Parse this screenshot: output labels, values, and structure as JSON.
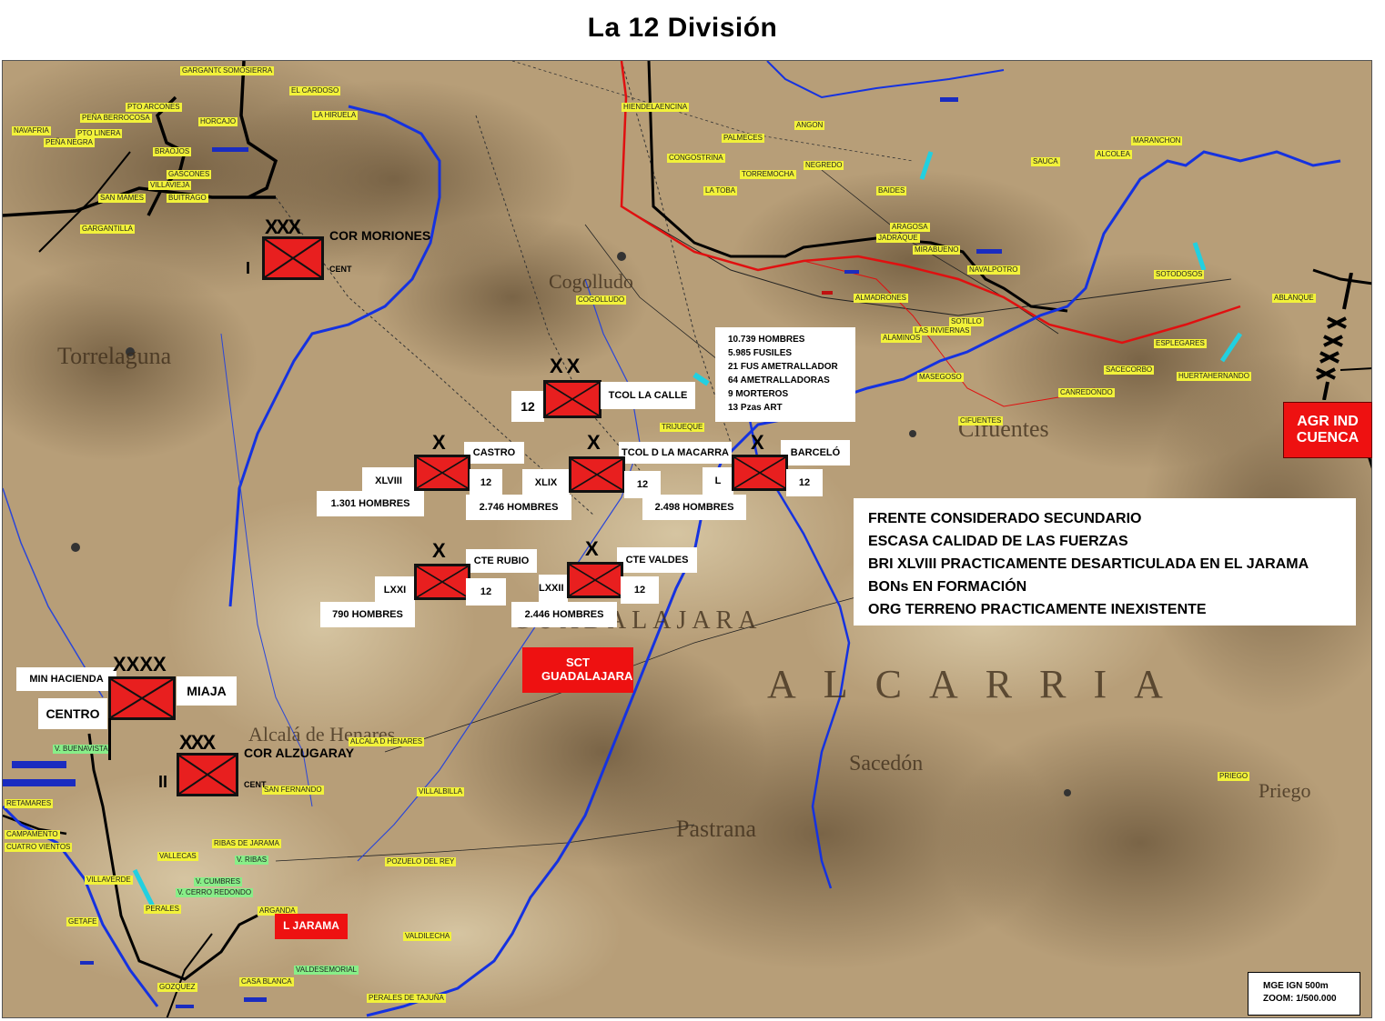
{
  "title": "La 12 División",
  "colors": {
    "unit_fill": "#e81f1f",
    "river": "#1532e0",
    "front_line": "#e01010",
    "map_base": "#b79e78"
  },
  "corps": [
    {
      "echelon": "XXX",
      "name": "COR MORIONES",
      "number": "I",
      "sub": "CENT"
    },
    {
      "echelon": "XXX",
      "name": "COR ALZUGARAY",
      "number": "II",
      "sub": "CENT"
    }
  ],
  "army": {
    "echelon": "XXXX",
    "name": "MIAJA",
    "top_label": "MIN HACIENDA",
    "side_label": "CENTRO"
  },
  "division": {
    "echelon": "XX",
    "number": "12",
    "commander": "TCOL LA CALLE"
  },
  "brigades": [
    {
      "echelon": "X",
      "number": "XLVIII",
      "commander": "CASTRO",
      "parent": "12",
      "strength": "1.301  HOMBRES"
    },
    {
      "echelon": "X",
      "number": "XLIX",
      "commander": "TCOL D LA MACARRA",
      "parent": "12",
      "strength": "2.746 HOMBRES"
    },
    {
      "echelon": "X",
      "number": "L",
      "commander": "BARCELÓ",
      "parent": "12",
      "strength": "2.498 HOMBRES"
    },
    {
      "echelon": "X",
      "number": "LXXI",
      "commander": "CTE RUBIO",
      "parent": "12",
      "strength": "790 HOMBRES"
    },
    {
      "echelon": "X",
      "number": "LXXII",
      "commander": "CTE VALDES",
      "parent": "12",
      "strength": "2.446 HOMBRES"
    }
  ],
  "stats": [
    "10.739  HOMBRES",
    "5.985 FUSILES",
    "21 FUS AMETRALLADOR",
    "64 AMETRALLADORAS",
    "9 MORTEROS",
    "13 Pzas ART"
  ],
  "notes": [
    "FRENTE CONSIDERADO SECUNDARIO",
    "ESCASA CALIDAD DE LAS FUERZAS",
    "BRI XLVIII PRACTICAMENTE DESARTICULADA EN EL JARAMA",
    "BONs EN FORMACIÓN",
    "ORG TERRENO PRACTICAMENTE INEXISTENTE"
  ],
  "sector_labels": {
    "guadalajara": "SCT GUADALAJARA",
    "jarama": "L JARAMA",
    "cuenca": "AGR IND CUENCA"
  },
  "scale": {
    "line1": "MGE IGN 500m",
    "line2": "ZOOM: 1/500.000"
  },
  "terrain_names": {
    "torrelaguna": "Torrelaguna",
    "cogolludo": "Cogolludo",
    "cifuentes": "Cifuentes",
    "sacedon": "Sacedón",
    "pastrana": "Pastrana",
    "priego": "Priego",
    "alcala": "Alcalá de Henares",
    "guadalajara": "GUADALAJARA",
    "alcarria": "ALCARRIA"
  },
  "places": [
    {
      "name": "GARGANTONES"
    },
    {
      "name": "SOMOSIERRA"
    },
    {
      "name": "PTO ARCONES"
    },
    {
      "name": "PEÑA BERROCOSA"
    },
    {
      "name": "NAVAFRIA"
    },
    {
      "name": "PTO LINERA"
    },
    {
      "name": "PEÑA NEGRA"
    },
    {
      "name": "EL CARDOSO"
    },
    {
      "name": "LA HIRUELA"
    },
    {
      "name": "HORCAJO"
    },
    {
      "name": "BRAOJOS"
    },
    {
      "name": "GASCONES"
    },
    {
      "name": "VILLAVIEJA"
    },
    {
      "name": "BUITRAGO"
    },
    {
      "name": "SAN MAMES"
    },
    {
      "name": "GARGANTILLA"
    },
    {
      "name": "HIENDELAENCINA"
    },
    {
      "name": "CONGOSTRINA"
    },
    {
      "name": "PALMECES"
    },
    {
      "name": "ANGON"
    },
    {
      "name": "NEGREDO"
    },
    {
      "name": "TORREMOCHA"
    },
    {
      "name": "LA TOBA"
    },
    {
      "name": "BAIDES"
    },
    {
      "name": "ALCOLEA"
    },
    {
      "name": "SAUCA"
    },
    {
      "name": "MARANCHON"
    },
    {
      "name": "JADRAQUE"
    },
    {
      "name": "ARAGOSA"
    },
    {
      "name": "MIRABUENO"
    },
    {
      "name": "NAVALPOTRO"
    },
    {
      "name": "COGOLLUDO"
    },
    {
      "name": "ALMADRONES"
    },
    {
      "name": "SOTILLO"
    },
    {
      "name": "LAS INVIERNAS"
    },
    {
      "name": "ALAMINOS"
    },
    {
      "name": "MASEGOSO"
    },
    {
      "name": "CIFUENTES"
    },
    {
      "name": "ESPLEGARES"
    },
    {
      "name": "SOTODOSOS"
    },
    {
      "name": "ABLANQUE"
    },
    {
      "name": "HUERTAHERNANDO"
    },
    {
      "name": "SACECORBO"
    },
    {
      "name": "CANREDONDO"
    },
    {
      "name": "TRIJUEQUE"
    },
    {
      "name": "ALCALA D HENARES"
    },
    {
      "name": "VALLECAS"
    },
    {
      "name": "V. RIBAS"
    },
    {
      "name": "GETAFE"
    },
    {
      "name": "VILLAVERDE"
    },
    {
      "name": "PERALES"
    },
    {
      "name": "VALDILECHA"
    },
    {
      "name": "POZUELO DEL REY"
    },
    {
      "name": "RIBAS DE JARAMA"
    },
    {
      "name": "V. CUMBRES"
    },
    {
      "name": "V. CERRO REDONDO"
    },
    {
      "name": "ARGANDA"
    },
    {
      "name": "VALDESEMORIAL"
    },
    {
      "name": "PERALES DE TAJUÑA"
    },
    {
      "name": "GOZQUEZ"
    },
    {
      "name": "CASA BLANCA"
    },
    {
      "name": "V. BUENAVISTA"
    },
    {
      "name": "RETAMARES"
    },
    {
      "name": "CAMPAMENTO"
    },
    {
      "name": "CUATRO VIENTOS"
    },
    {
      "name": "VILLALBILLA"
    },
    {
      "name": "SAN FERNANDO"
    },
    {
      "name": "PRIEGO"
    }
  ]
}
